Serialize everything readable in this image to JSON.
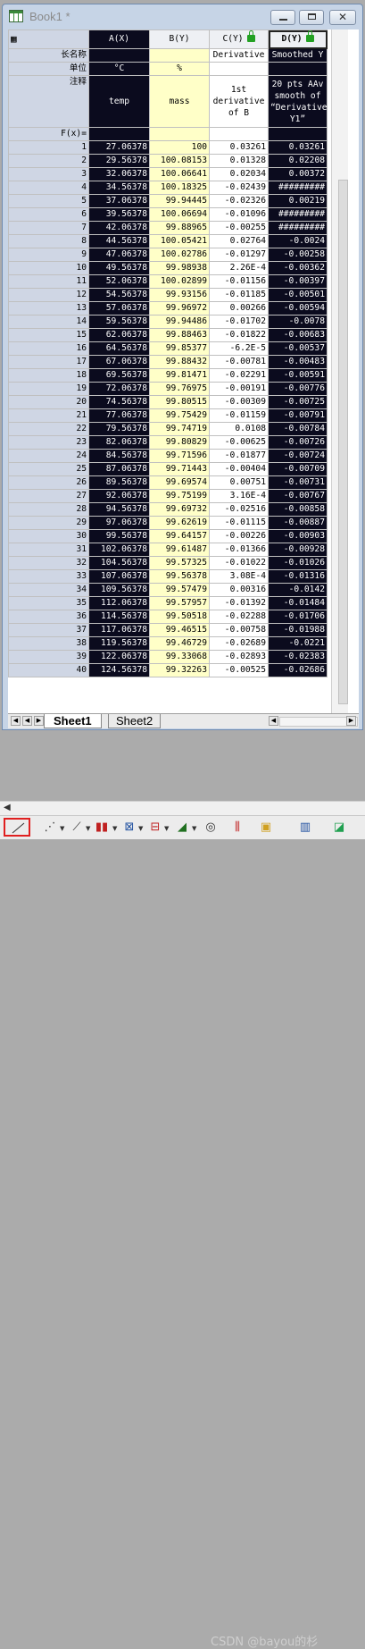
{
  "window": {
    "title": "Book1 *",
    "min_label": "minimize",
    "close_glyph": "✕"
  },
  "columns": {
    "corner_icon": "worksheet-corner-icon",
    "a": "A(X)",
    "b": "B(Y)",
    "c": "C(Y)",
    "d": "D(Y)"
  },
  "labels": {
    "long_name": "长名称",
    "units": "单位",
    "comments": "注释",
    "fx": "F(x)="
  },
  "meta": {
    "long_name": {
      "a": "",
      "b": "",
      "c": "Derivative",
      "d": "Smoothed Y"
    },
    "units": {
      "a": "°C",
      "b": "%",
      "c": "",
      "d": ""
    },
    "comments": {
      "a": "temp",
      "b": "mass",
      "c": "1st derivative of B",
      "d": "20 pts AAv smooth of “Derivative Y1”"
    }
  },
  "rows": [
    [
      "1",
      "27.06378",
      "100",
      "0.03261",
      "0.03261"
    ],
    [
      "2",
      "29.56378",
      "100.08153",
      "0.01328",
      "0.02208"
    ],
    [
      "3",
      "32.06378",
      "100.06641",
      "0.02034",
      "0.00372"
    ],
    [
      "4",
      "34.56378",
      "100.18325",
      "-0.02439",
      "#########"
    ],
    [
      "5",
      "37.06378",
      "99.94445",
      "-0.02326",
      "0.00219"
    ],
    [
      "6",
      "39.56378",
      "100.06694",
      "-0.01096",
      "#########"
    ],
    [
      "7",
      "42.06378",
      "99.88965",
      "-0.00255",
      "#########"
    ],
    [
      "8",
      "44.56378",
      "100.05421",
      "0.02764",
      "-0.0024"
    ],
    [
      "9",
      "47.06378",
      "100.02786",
      "-0.01297",
      "-0.00258"
    ],
    [
      "10",
      "49.56378",
      "99.98938",
      "2.26E-4",
      "-0.00362"
    ],
    [
      "11",
      "52.06378",
      "100.02899",
      "-0.01156",
      "-0.00397"
    ],
    [
      "12",
      "54.56378",
      "99.93156",
      "-0.01185",
      "-0.00501"
    ],
    [
      "13",
      "57.06378",
      "99.96972",
      "0.00266",
      "-0.00594"
    ],
    [
      "14",
      "59.56378",
      "99.94486",
      "-0.01702",
      "-0.0078"
    ],
    [
      "15",
      "62.06378",
      "99.88463",
      "-0.01822",
      "-0.00683"
    ],
    [
      "16",
      "64.56378",
      "99.85377",
      "-6.2E-5",
      "-0.00537"
    ],
    [
      "17",
      "67.06378",
      "99.88432",
      "-0.00781",
      "-0.00483"
    ],
    [
      "18",
      "69.56378",
      "99.81471",
      "-0.02291",
      "-0.00591"
    ],
    [
      "19",
      "72.06378",
      "99.76975",
      "-0.00191",
      "-0.00776"
    ],
    [
      "20",
      "74.56378",
      "99.80515",
      "-0.00309",
      "-0.00725"
    ],
    [
      "21",
      "77.06378",
      "99.75429",
      "-0.01159",
      "-0.00791"
    ],
    [
      "22",
      "79.56378",
      "99.74719",
      "0.0108",
      "-0.00784"
    ],
    [
      "23",
      "82.06378",
      "99.80829",
      "-0.00625",
      "-0.00726"
    ],
    [
      "24",
      "84.56378",
      "99.71596",
      "-0.01877",
      "-0.00724"
    ],
    [
      "25",
      "87.06378",
      "99.71443",
      "-0.00404",
      "-0.00709"
    ],
    [
      "26",
      "89.56378",
      "99.69574",
      "0.00751",
      "-0.00731"
    ],
    [
      "27",
      "92.06378",
      "99.75199",
      "3.16E-4",
      "-0.00767"
    ],
    [
      "28",
      "94.56378",
      "99.69732",
      "-0.02516",
      "-0.00858"
    ],
    [
      "29",
      "97.06378",
      "99.62619",
      "-0.01115",
      "-0.00887"
    ],
    [
      "30",
      "99.56378",
      "99.64157",
      "-0.00226",
      "-0.00903"
    ],
    [
      "31",
      "102.06378",
      "99.61487",
      "-0.01366",
      "-0.00928"
    ],
    [
      "32",
      "104.56378",
      "99.57325",
      "-0.01022",
      "-0.01026"
    ],
    [
      "33",
      "107.06378",
      "99.56378",
      "3.08E-4",
      "-0.01316"
    ],
    [
      "34",
      "109.56378",
      "99.57479",
      "0.00316",
      "-0.0142"
    ],
    [
      "35",
      "112.06378",
      "99.57957",
      "-0.01392",
      "-0.01484"
    ],
    [
      "36",
      "114.56378",
      "99.50518",
      "-0.02288",
      "-0.01706"
    ],
    [
      "37",
      "117.06378",
      "99.46515",
      "-0.00758",
      "-0.01988"
    ],
    [
      "38",
      "119.56378",
      "99.46729",
      "-0.02689",
      "-0.0221"
    ],
    [
      "39",
      "122.06378",
      "99.33068",
      "-0.02893",
      "-0.02383"
    ],
    [
      "40",
      "124.56378",
      "99.32263",
      "-0.00525",
      "-0.02686"
    ]
  ],
  "sheets": [
    "Sheet1",
    "Sheet2"
  ],
  "toolbar": [
    "line-plot-icon",
    "scatter-icon",
    "line-symbol-icon",
    "column-icon",
    "histogram-icon",
    "boxplot-icon",
    "area-icon",
    "contour-icon",
    "polar-icon",
    "stock-icon",
    "gadget-icon",
    "3d-icon",
    "surface-icon"
  ],
  "watermark": "CSDN @bayou的杉"
}
